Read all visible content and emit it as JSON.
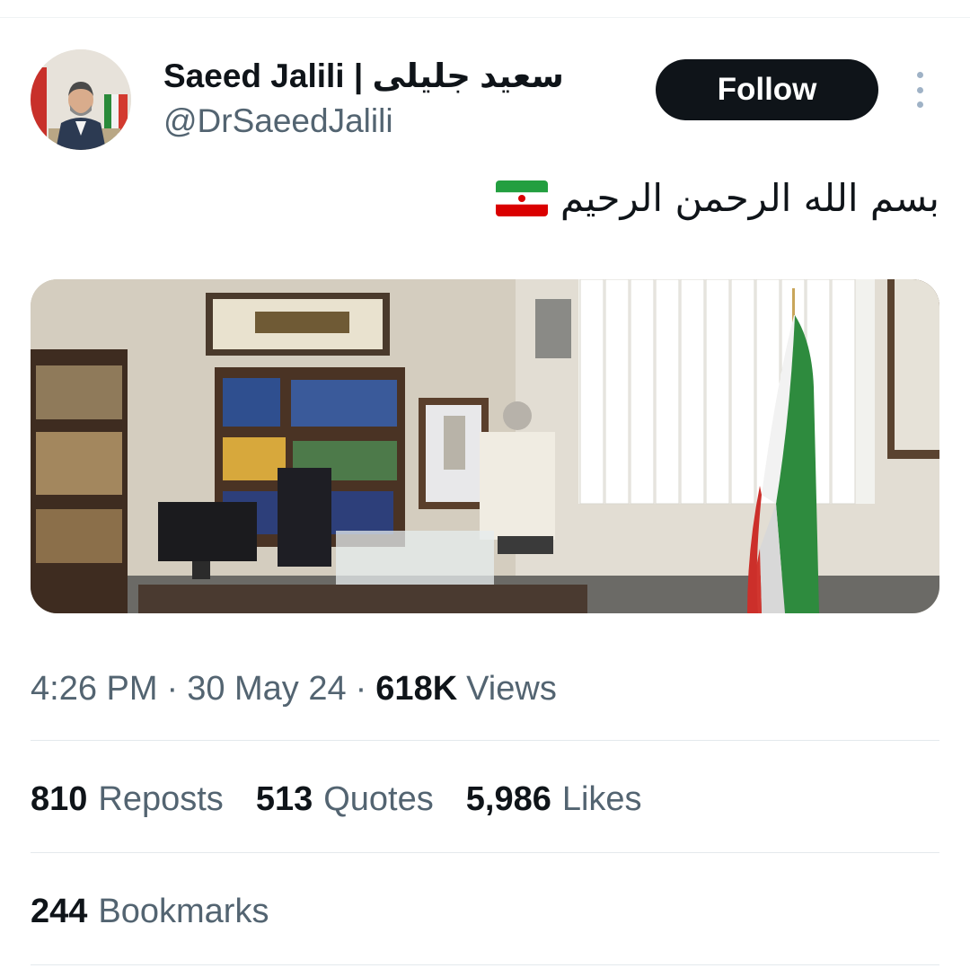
{
  "author": {
    "display_name": "Saeed Jalili | سعید جلیلی",
    "handle": "@DrSaeedJalili",
    "avatar_icon": "profile-photo"
  },
  "actions": {
    "follow_label": "Follow",
    "more_icon": "vertical-ellipsis-icon"
  },
  "tweet": {
    "text": "بسم الله الرحمن الرحیم",
    "emoji": "iran-flag-emoji"
  },
  "media": {
    "description_icon": "office-photo"
  },
  "meta": {
    "time": "4:26 PM",
    "separator": "·",
    "date": "30 May 24",
    "views_count": "618K",
    "views_label": "Views"
  },
  "stats": {
    "reposts_count": "810",
    "reposts_label": "Reposts",
    "quotes_count": "513",
    "quotes_label": "Quotes",
    "likes_count": "5,986",
    "likes_label": "Likes",
    "bookmarks_count": "244",
    "bookmarks_label": "Bookmarks"
  },
  "colors": {
    "text_primary": "#0f1419",
    "text_secondary": "#536471",
    "follow_bg": "#0f1419",
    "divider": "#e4e9ed"
  }
}
